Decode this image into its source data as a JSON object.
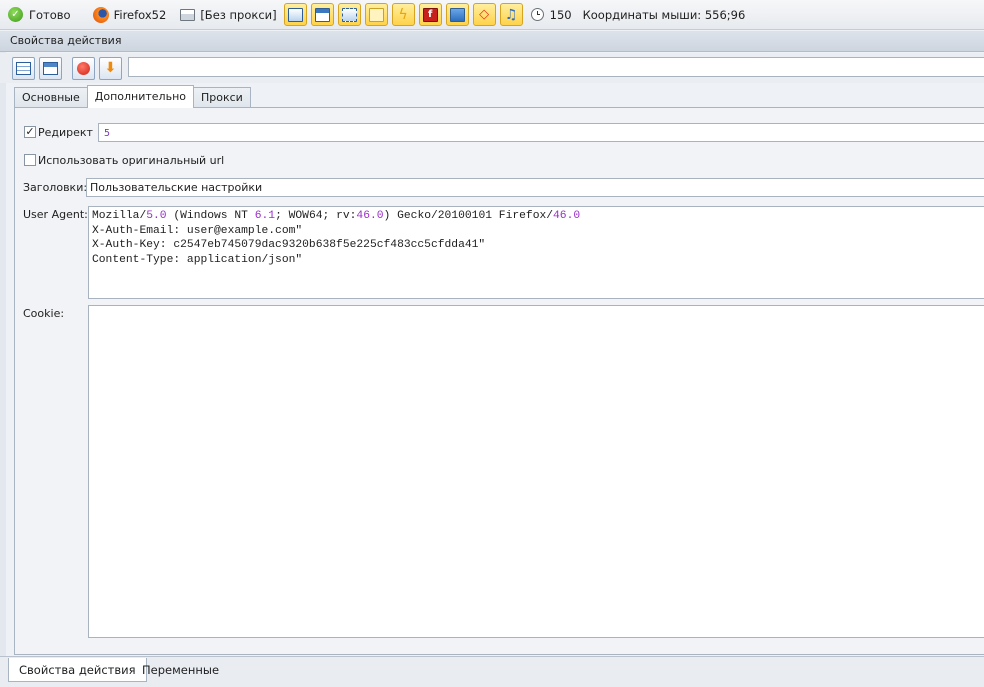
{
  "statusbar": {
    "status": "Готово",
    "browser": "Firefox52",
    "proxy": "[Без прокси]",
    "tool_buttons": [
      "image-icon",
      "window-icon",
      "frame-icon",
      "flash-text-icon",
      "bolt-icon",
      "flash-icon",
      "monitor-icon",
      "diamond-icon",
      "music-icon"
    ],
    "counter": "150",
    "mouse_coords": "Координаты мыши: 556;96"
  },
  "panel": {
    "title": "Свойства действия",
    "url_value": ""
  },
  "tabs": [
    "Основные",
    "Дополнительно",
    "Прокси"
  ],
  "form": {
    "redirect_label": "Редирект",
    "redirect_checked": true,
    "redirect_value": "5",
    "original_url_label": "Использовать оригинальный url",
    "original_url_checked": false,
    "headers_label": "Заголовки:",
    "headers_value": "Пользовательские настройки",
    "user_agent_label": "User Agent:",
    "user_agent_lines": [
      "Mozilla/5.0 (Windows NT 6.1; WOW64; rv:46.0) Gecko/20100101 Firefox/46.0",
      "X-Auth-Email: user@example.com\"",
      "X-Auth-Key: c2547eb745079dac9320b638f5e225cf483cc5cfdda41\"",
      "Content-Type: application/json\""
    ],
    "cookie_label": "Cookie:",
    "cookie_value": ""
  },
  "bottom_tabs": [
    "Свойства действия",
    "Переменные"
  ],
  "colors": {
    "accent_yellow": "#ffd24a",
    "number_purple": "#9b30c9",
    "panel_blue": "#cdd5df"
  }
}
